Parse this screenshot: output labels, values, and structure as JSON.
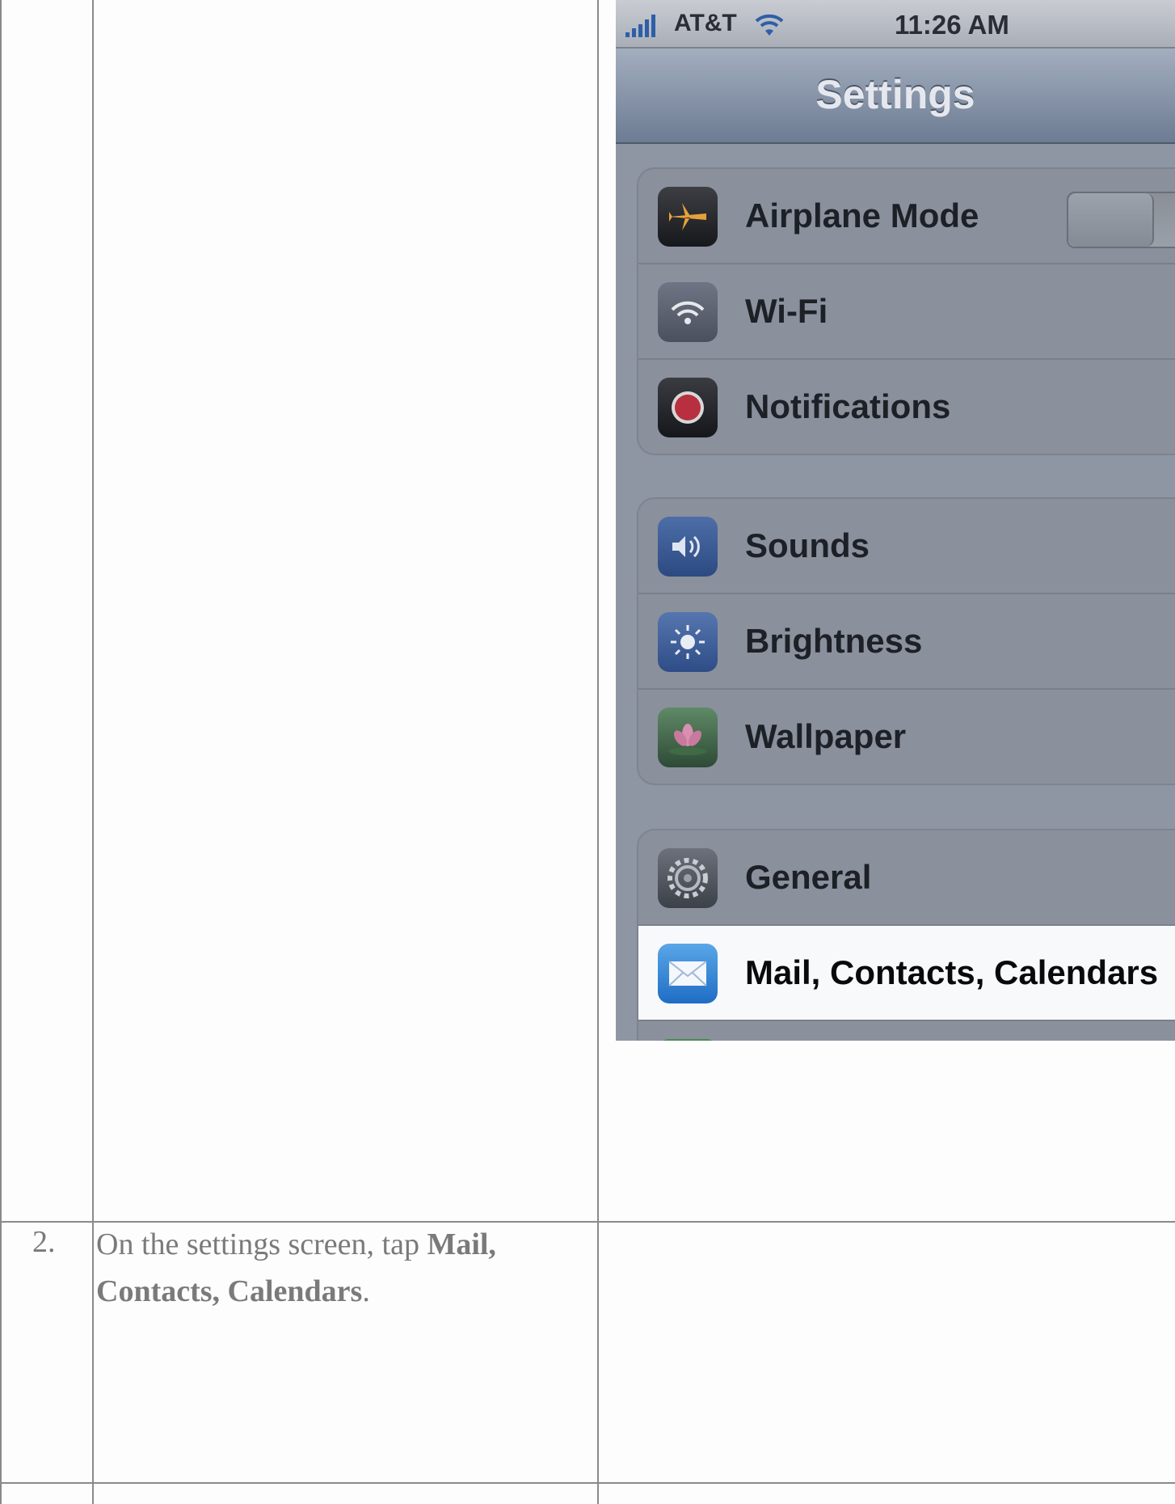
{
  "step": {
    "number": "2.",
    "text_before": "On the settings screen, tap ",
    "bold_text": "Mail, Contacts, Calendars",
    "text_after": "."
  },
  "phone": {
    "status": {
      "carrier": "AT&T",
      "time": "11:26 AM"
    },
    "nav_title": "Settings",
    "groups": [
      [
        {
          "label": "Airplane Mode",
          "icon": "airplane-icon"
        },
        {
          "label": "Wi-Fi",
          "icon": "wifi-icon"
        },
        {
          "label": "Notifications",
          "icon": "notifications-icon"
        }
      ],
      [
        {
          "label": "Sounds",
          "icon": "speaker-icon"
        },
        {
          "label": "Brightness",
          "icon": "sun-icon"
        },
        {
          "label": "Wallpaper",
          "icon": "flower-icon"
        }
      ],
      [
        {
          "label": "General",
          "icon": "gear-icon"
        },
        {
          "label": "Mail, Contacts, Calendars",
          "icon": "mail-icon"
        }
      ]
    ]
  }
}
